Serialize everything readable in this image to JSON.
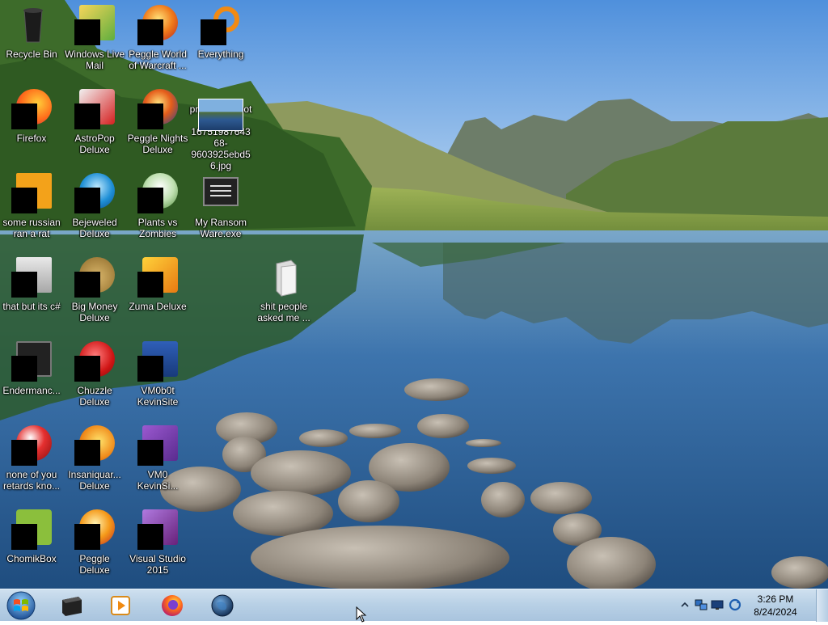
{
  "desktop": {
    "icons": [
      {
        "label": "Recycle Bin"
      },
      {
        "label": "Windows Live Mail"
      },
      {
        "label": "Peggle World of Warcraft ..."
      },
      {
        "label": "Everything"
      },
      {
        "label": "Firefox"
      },
      {
        "label": "AstroPop Deluxe"
      },
      {
        "label": "Peggle Nights Deluxe"
      },
      {
        "label": "premium_photo-1675198764368-9603925ebd56.jpg"
      },
      {
        "label": "some russian ran a rat"
      },
      {
        "label": "Bejeweled Deluxe"
      },
      {
        "label": "Plants vs Zombies"
      },
      {
        "label": "My Ransom Ware.exe"
      },
      {
        "label": "that but its c#"
      },
      {
        "label": "Big Money Deluxe"
      },
      {
        "label": "Zuma Deluxe"
      },
      {
        "label": "shit people asked me ..."
      },
      {
        "label": "Endermanc..."
      },
      {
        "label": "Chuzzle Deluxe"
      },
      {
        "label": "VM0b0t KevinSite"
      },
      {
        "label": "none of you retards kno..."
      },
      {
        "label": "Insaniquar... Deluxe"
      },
      {
        "label": "VM0 KevinSi..."
      },
      {
        "label": "ChomikBox"
      },
      {
        "label": "Peggle Deluxe"
      },
      {
        "label": "Visual Studio 2015"
      }
    ]
  },
  "taskbar": {
    "clock": {
      "time": "3:26 PM",
      "date": "8/24/2024"
    }
  },
  "colors": {
    "sky_top": "#5b9ae0",
    "sky_bottom": "#c3dcf3",
    "lake": "#3f78b4",
    "taskbar": "#b9d1e6"
  }
}
